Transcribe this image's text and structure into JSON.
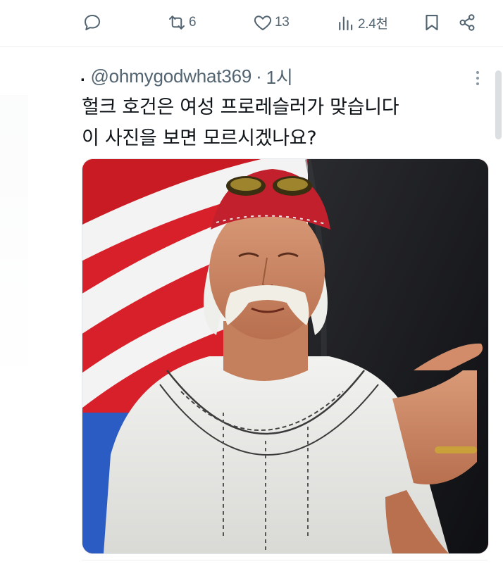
{
  "actions": {
    "reply": {
      "icon": "reply-icon"
    },
    "retweet": {
      "icon": "retweet-icon",
      "count": "6"
    },
    "like": {
      "icon": "heart-icon",
      "count": "13"
    },
    "views": {
      "icon": "views-icon",
      "count": "2.4천"
    },
    "bookmark": {
      "icon": "bookmark-icon"
    },
    "share": {
      "icon": "share-icon"
    }
  },
  "tweet": {
    "lead_mark": ".",
    "handle": "@ohmygodwhat369",
    "separator": "·",
    "time": "1시",
    "text_lines": [
      "헐크 호건은 여성 프로레슬러가 맞습니다",
      "이 사진을 보면 모르시겠나요?"
    ],
    "image": {
      "alt": "photo"
    }
  },
  "colors": {
    "icon_gray": "#536471",
    "text": "#0f1419",
    "divider": "#eef0f2"
  }
}
